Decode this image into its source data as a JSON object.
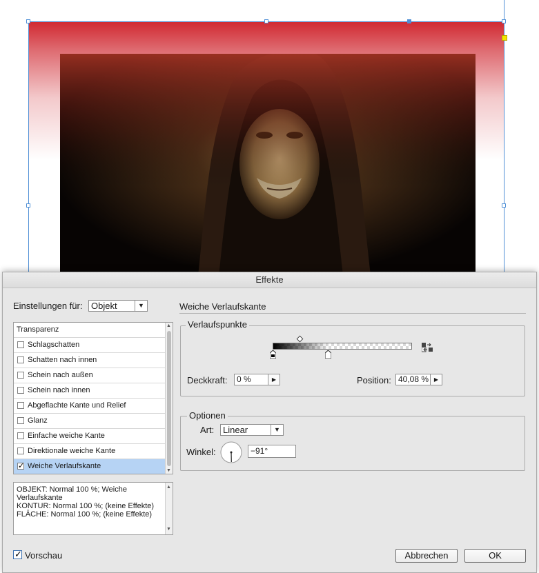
{
  "dialog": {
    "title": "Effekte",
    "settings_label": "Einstellungen für:",
    "settings_value": "Objekt",
    "section_title": "Weiche Verlaufskante",
    "effects_list": [
      {
        "label": "Transparenz",
        "has_checkbox": false,
        "checked": false,
        "selected": false
      },
      {
        "label": "Schlagschatten",
        "has_checkbox": true,
        "checked": false,
        "selected": false
      },
      {
        "label": "Schatten nach innen",
        "has_checkbox": true,
        "checked": false,
        "selected": false
      },
      {
        "label": "Schein nach außen",
        "has_checkbox": true,
        "checked": false,
        "selected": false
      },
      {
        "label": "Schein nach innen",
        "has_checkbox": true,
        "checked": false,
        "selected": false
      },
      {
        "label": "Abgeflachte Kante und Relief",
        "has_checkbox": true,
        "checked": false,
        "selected": false
      },
      {
        "label": "Glanz",
        "has_checkbox": true,
        "checked": false,
        "selected": false
      },
      {
        "label": "Einfache weiche Kante",
        "has_checkbox": true,
        "checked": false,
        "selected": false
      },
      {
        "label": "Direktionale weiche Kante",
        "has_checkbox": true,
        "checked": false,
        "selected": false
      },
      {
        "label": "Weiche Verlaufskante",
        "has_checkbox": true,
        "checked": true,
        "selected": true
      }
    ],
    "summary_lines": [
      "OBJEKT: Normal 100 %; Weiche Verlaufskante",
      "KONTUR: Normal 100 %; (keine Effekte)",
      "FLÄCHE: Normal 100 %; (keine Effekte)"
    ],
    "gradient_group": {
      "title": "Verlaufspunkte",
      "opacity_label": "Deckkraft:",
      "opacity_value": "0 %",
      "position_label": "Position:",
      "position_value": "40,08 %"
    },
    "options_group": {
      "title": "Optionen",
      "type_label": "Art:",
      "type_value": "Linear",
      "angle_label": "Winkel:",
      "angle_value": "−91°"
    },
    "preview_label": "Vorschau",
    "preview_checked": true,
    "cancel_label": "Abbrechen",
    "ok_label": "OK"
  },
  "colors": {
    "frame_red": "#d12a32",
    "selection_blue": "#4f8fd6",
    "list_selected": "#b6d3f4",
    "dialog_bg": "#e7e7e7"
  },
  "icons": {
    "dropdown": "chevron-down-icon",
    "stepper": "triangle-right-icon",
    "reverse_gradient": "reverse-gradient-icon",
    "checkmark": "checkmark-icon"
  }
}
